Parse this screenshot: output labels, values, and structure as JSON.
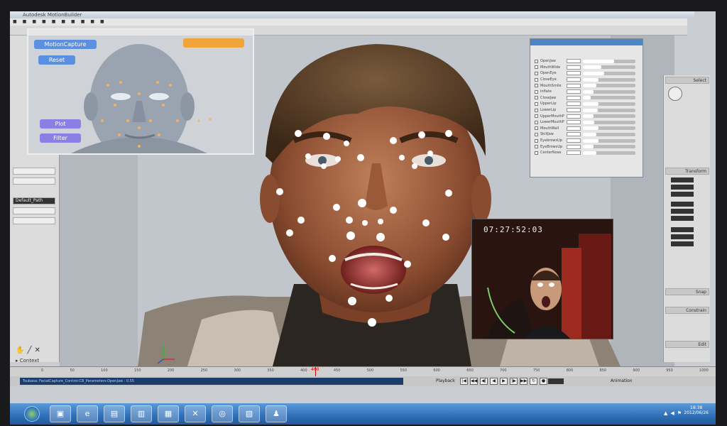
{
  "window": {
    "title": "Autodesk MotionBuilder"
  },
  "face_panel": {
    "buttons": {
      "mocap": "MotionCapture",
      "reset": "Reset",
      "plot": "Plot",
      "filter": "Filter"
    }
  },
  "props_panel": {
    "rows": [
      {
        "name": "OpenJaw",
        "level": 0.6
      },
      {
        "name": "MouthWide",
        "level": 0.35
      },
      {
        "name": "OpenEye",
        "level": 0.4
      },
      {
        "name": "CloseEye",
        "level": 0.3
      },
      {
        "name": "MouthSmile",
        "level": 0.25
      },
      {
        "name": "Inflate",
        "level": 0.2
      },
      {
        "name": "CloseJaw",
        "level": 0.15
      },
      {
        "name": "UpperLip",
        "level": 0.3
      },
      {
        "name": "LowerLip",
        "level": 0.28
      },
      {
        "name": "UpperMouthPress",
        "level": 0.2
      },
      {
        "name": "LowerMouthPress",
        "level": 0.22
      },
      {
        "name": "MouthWall",
        "level": 0.3
      },
      {
        "name": "SkillJaw",
        "level": 0.25
      },
      {
        "name": "EyebrowsUp",
        "level": 0.3
      },
      {
        "name": "EyeBrowsUp",
        "level": 0.2
      },
      {
        "name": "CenterNose",
        "level": 0.25
      }
    ]
  },
  "video_inset": {
    "timecode": "07:27:52:03"
  },
  "right_panel": {
    "sections": [
      "Select",
      "Transform",
      "Snap",
      "Constrain",
      "Edit"
    ]
  },
  "left_panel": {
    "context_label": "Context",
    "default_path": "Default_Path"
  },
  "timeline": {
    "ticks": [
      "0",
      "50",
      "100",
      "150",
      "200",
      "250",
      "300",
      "350",
      "400",
      "450",
      "500",
      "550",
      "600",
      "650",
      "700",
      "750",
      "800",
      "850",
      "900",
      "950",
      "1000"
    ],
    "current_frame": "460"
  },
  "statusbar": {
    "text": "Tsubasa: FacialCapture_Control:CB_Parameters:OpenJaw : 0.55",
    "playback_label": "Playback",
    "animation_label": "Animation"
  },
  "taskbar": {
    "time": "18:38",
    "date": "2012/06/26"
  }
}
